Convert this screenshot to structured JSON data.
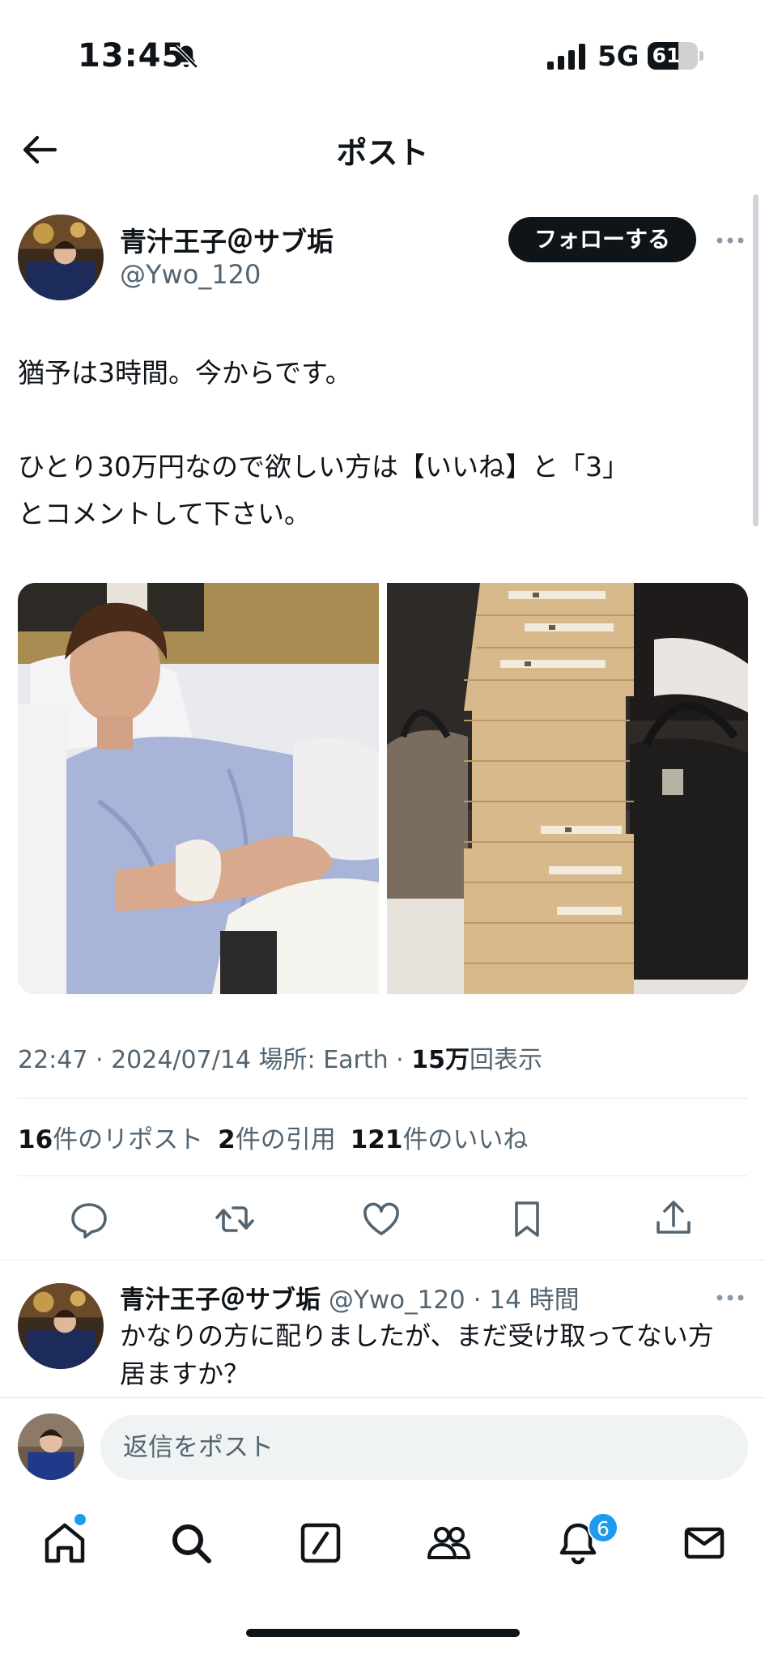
{
  "status_bar": {
    "time": "13:45",
    "network": "5G",
    "battery": "61",
    "battery_fraction": 0.61
  },
  "header": {
    "title": "ポスト"
  },
  "author": {
    "name": "青汁王子＠サブ垢",
    "handle": "@Ywo_120",
    "follow_label": "フォローする"
  },
  "post": {
    "text": "猶予は3時間。今からです。\n\nひとり30万円なので欲しい方は【いいね】と「3」\nとコメントして下さい。",
    "meta": {
      "time": "22:47",
      "date": "2024/07/14",
      "location": "場所: Earth",
      "views_count": "15万",
      "views_label": "回表示"
    },
    "stats": {
      "reposts_count": "16",
      "reposts_label": "件のリポスト",
      "quotes_count": "2",
      "quotes_label": "件の引用",
      "likes_count": "121",
      "likes_label": "件のいいね"
    }
  },
  "actions": [
    "reply-icon",
    "repost-icon",
    "like-icon",
    "bookmark-icon",
    "share-icon"
  ],
  "reply": {
    "name": "青汁王子＠サブ垢",
    "handle": "@Ywo_120",
    "time": "· 14 時間",
    "text": "かなりの方に配りましたが、まだ受け取ってない方居ますか？"
  },
  "compose": {
    "placeholder": "返信をポスト"
  },
  "nav": {
    "items": [
      "home-icon",
      "search-icon",
      "compose-icon",
      "communities-icon",
      "notifications-icon",
      "messages-icon"
    ],
    "notification_badge": "6"
  },
  "colors": {
    "text": "#0f1419",
    "secondary": "#536471",
    "accent": "#1d9bf0",
    "input_bg": "#eff3f4"
  }
}
